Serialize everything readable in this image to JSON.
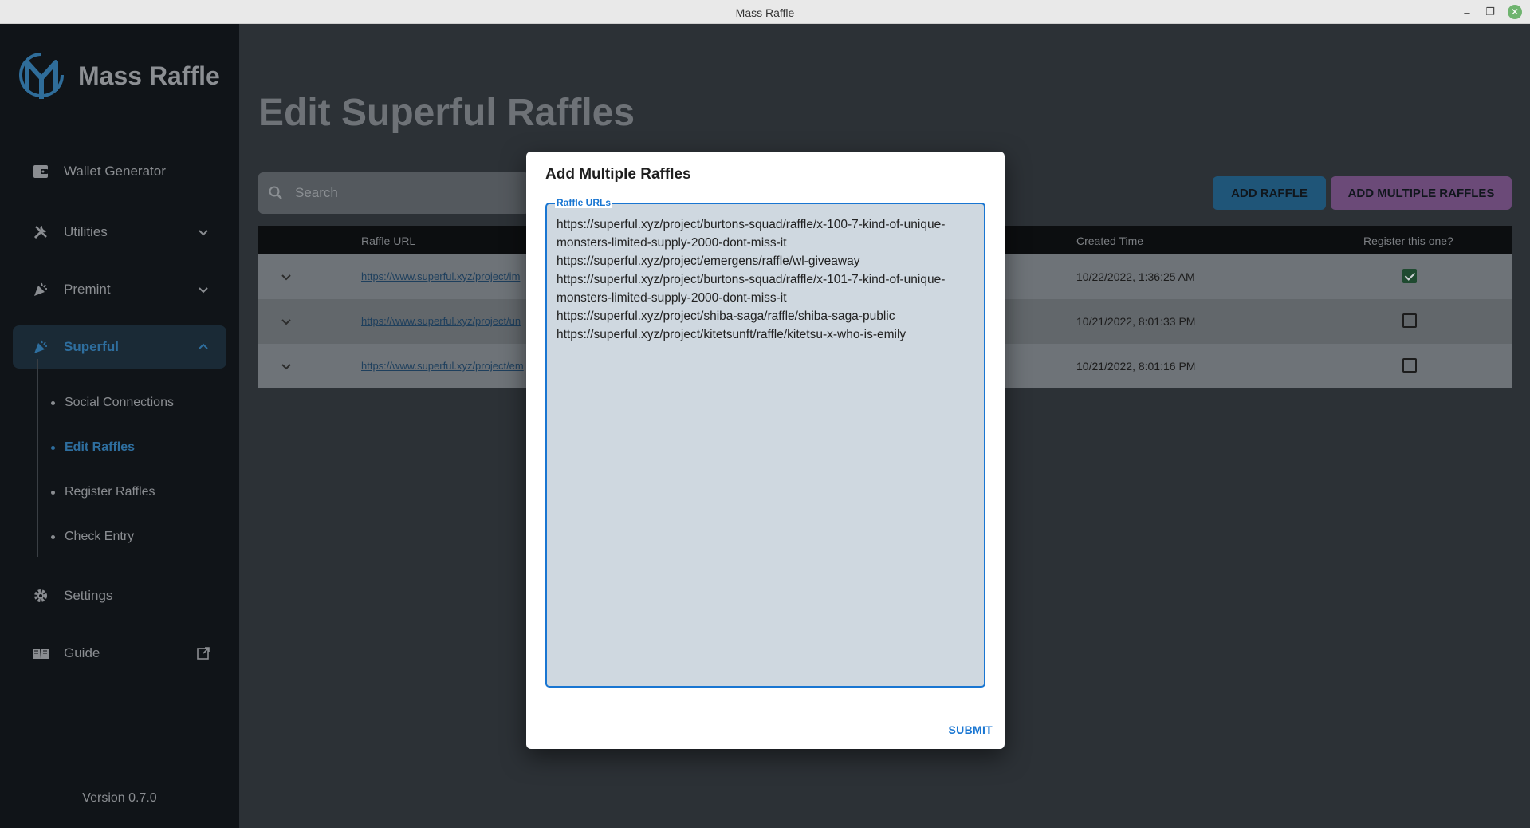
{
  "window": {
    "title": "Mass Raffle",
    "minimize": "–",
    "maximize": "❐",
    "close": "✕"
  },
  "sidebar": {
    "brand": "Mass Raffle",
    "items": [
      {
        "label": "Wallet Generator",
        "icon": "wallet-icon"
      },
      {
        "label": "Utilities",
        "icon": "tools-icon"
      },
      {
        "label": "Premint",
        "icon": "party-icon"
      },
      {
        "label": "Superful",
        "icon": "party-icon"
      },
      {
        "label": "Settings",
        "icon": "gear-icon"
      },
      {
        "label": "Guide",
        "icon": "book-icon"
      }
    ],
    "subitems": [
      {
        "label": "Social Connections"
      },
      {
        "label": "Edit Raffles"
      },
      {
        "label": "Register Raffles"
      },
      {
        "label": "Check Entry"
      }
    ],
    "version": "Version 0.7.0"
  },
  "main": {
    "title": "Edit Superful Raffles",
    "search_placeholder": "Search",
    "add_raffle": "ADD RAFFLE",
    "add_multiple": "ADD MULTIPLE RAFFLES",
    "columns": [
      "Raffle URL",
      "Created Time",
      "Register this one?"
    ],
    "rows": [
      {
        "url": "https://www.superful.xyz/project/im",
        "time": "10/22/2022, 1:36:25 AM",
        "checked": true
      },
      {
        "url": "https://www.superful.xyz/project/un",
        "time": "10/21/2022, 8:01:33 PM",
        "checked": false
      },
      {
        "url": "https://www.superful.xyz/project/em",
        "time": "10/21/2022, 8:01:16 PM",
        "checked": false
      }
    ]
  },
  "dialog": {
    "title": "Add Multiple Raffles",
    "field_label": "Raffle URLs",
    "value": "https://superful.xyz/project/burtons-squad/raffle/x-100-7-kind-of-unique-monsters-limited-supply-2000-dont-miss-it\nhttps://superful.xyz/project/emergens/raffle/wl-giveaway\nhttps://superful.xyz/project/burtons-squad/raffle/x-101-7-kind-of-unique-monsters-limited-supply-2000-dont-miss-it\nhttps://superful.xyz/project/shiba-saga/raffle/shiba-saga-public\nhttps://superful.xyz/project/kitetsunft/raffle/kitetsu-x-who-is-emily",
    "submit": "SUBMIT"
  },
  "colors": {
    "accent": "#1976d2",
    "add_button": "#1f5578",
    "add_multiple_button": "#6b4a78"
  }
}
